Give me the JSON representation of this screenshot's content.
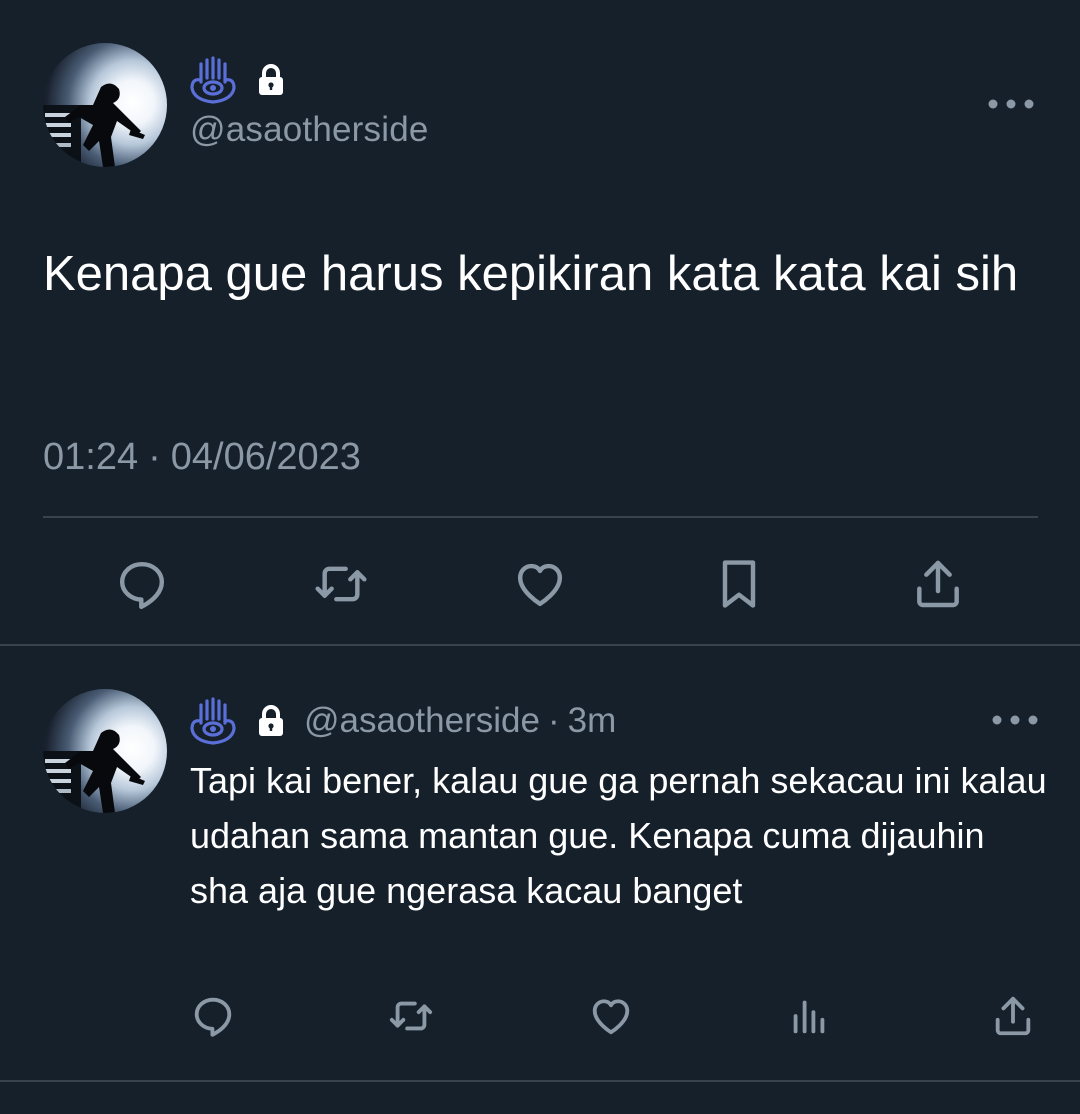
{
  "main_tweet": {
    "handle": "@asaotherside",
    "text": "Kenapa gue harus kepikiran kata kata kai sih",
    "time": "01:24",
    "separator": "·",
    "date": "04/06/2023",
    "actions": [
      "reply-icon",
      "retweet-icon",
      "like-icon",
      "bookmark-icon",
      "share-icon"
    ]
  },
  "reply": {
    "handle": "@asaotherside",
    "separator": "·",
    "time_ago": "3m",
    "text": "Tapi kai bener, kalau gue ga pernah sekacau ini kalau udahan sama mantan gue. Kenapa cuma dijauhin sha aja gue ngerasa kacau banget",
    "actions": [
      "reply-icon",
      "retweet-icon",
      "like-icon",
      "views-icon",
      "share-icon"
    ]
  },
  "colors": {
    "background": "#15202b",
    "text": "#ffffff",
    "secondary_text": "#8b98a5",
    "divider": "#38444d",
    "hamsa_blue": "#5b6fd8"
  }
}
